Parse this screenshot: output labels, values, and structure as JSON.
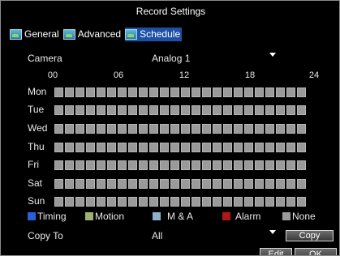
{
  "window": {
    "title": "Record Settings"
  },
  "tabs": [
    {
      "label": "General",
      "active": false
    },
    {
      "label": "Advanced",
      "active": false
    },
    {
      "label": "Schedule",
      "active": true
    }
  ],
  "camera": {
    "label": "Camera",
    "value": "Analog 1"
  },
  "hours": [
    "00",
    "06",
    "12",
    "18",
    "24"
  ],
  "days": [
    "Mon",
    "Tue",
    "Wed",
    "Thu",
    "Fri",
    "Sat",
    "Sun"
  ],
  "legend": [
    {
      "label": "Timing",
      "color": "#2b5fd9"
    },
    {
      "label": "Motion",
      "color": "#9eb36e"
    },
    {
      "label": "M & A",
      "color": "#8fb0c9"
    },
    {
      "label": "Alarm",
      "color": "#b01818"
    },
    {
      "label": "None",
      "color": "#9a9a9a"
    }
  ],
  "copy": {
    "label": "Copy To",
    "value": "All",
    "button": "Copy"
  },
  "footer": {
    "edit": "Edit",
    "ok": "OK"
  }
}
